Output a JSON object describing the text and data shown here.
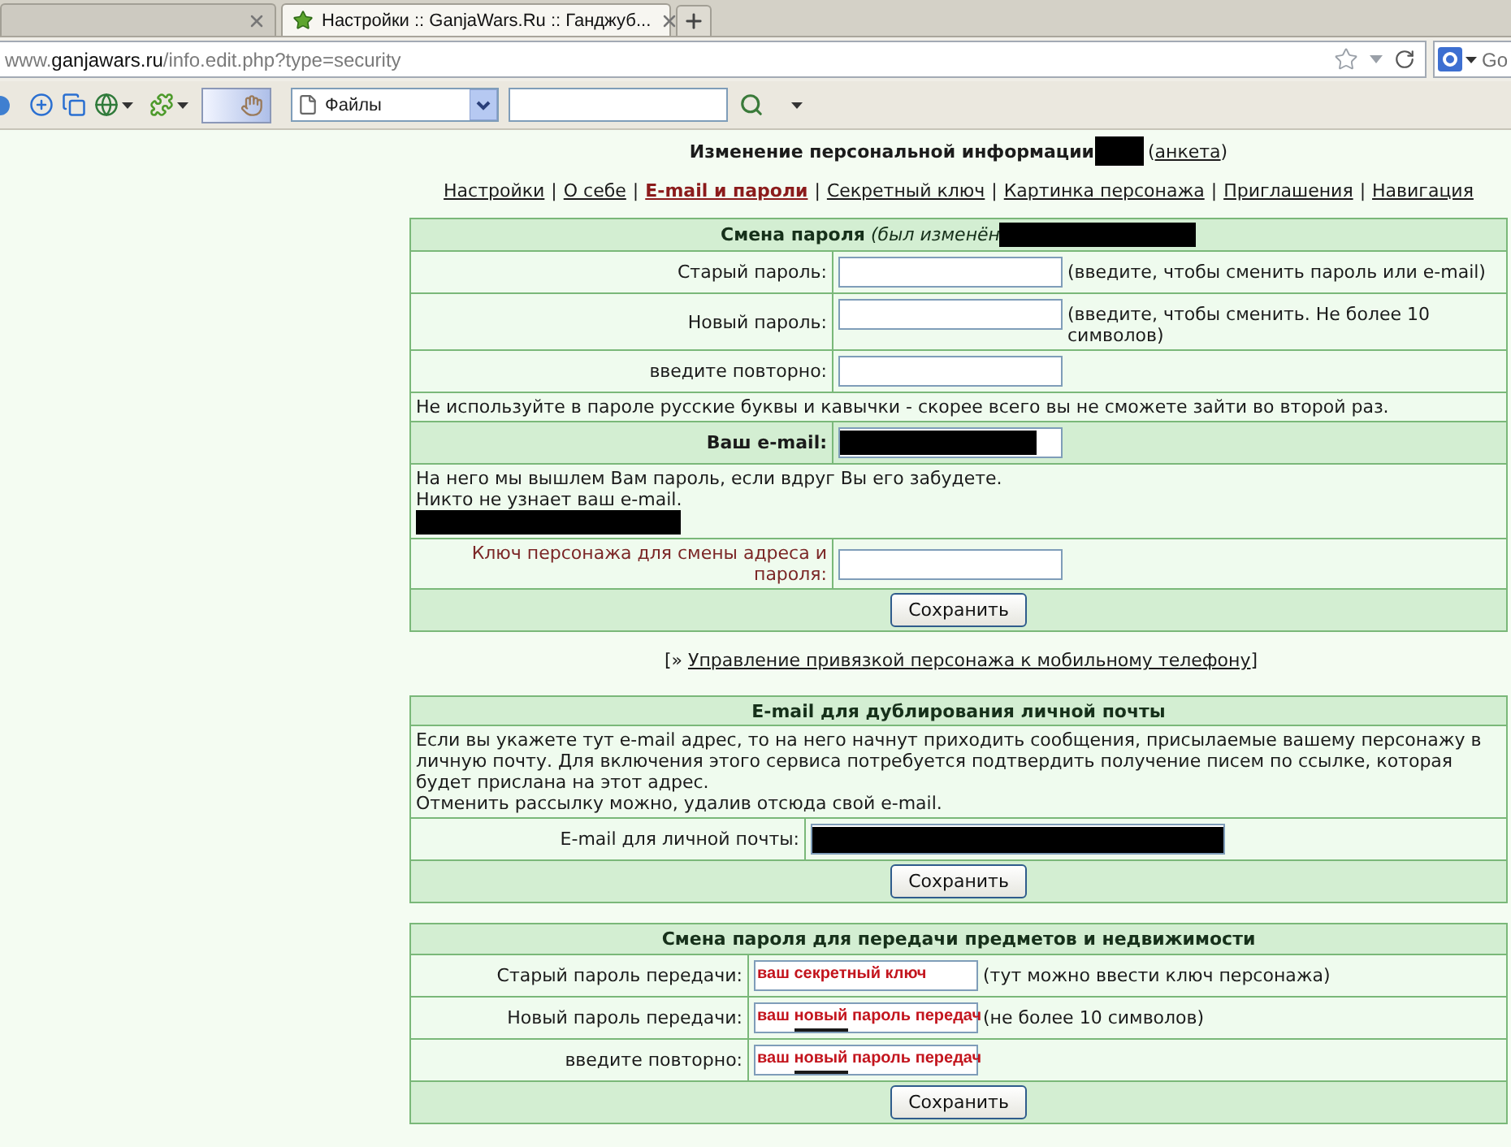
{
  "browser": {
    "tabs": [
      {
        "selected": false
      },
      {
        "title": "Настройки :: GanjaWars.Ru :: Ганджуб...",
        "selected": true
      }
    ],
    "address_bar": {
      "url_prefix": "www.",
      "url_domain": "ganjawars.ru",
      "url_path": "/info.edit.php?type=security"
    },
    "search_box": {
      "placeholder": "Go"
    },
    "toolbar": {
      "select": {
        "value": "Файлы"
      }
    }
  },
  "heading": {
    "text": "Изменение персональной информации",
    "name_redacted": true,
    "link": {
      "open": "(",
      "text": "анкета",
      "close": ")"
    }
  },
  "nav": [
    {
      "label": "Настройки",
      "selected": false,
      "separator": "|"
    },
    {
      "label": "О себе",
      "selected": false,
      "separator": "|"
    },
    {
      "label": "E-mail и пароли",
      "selected": true,
      "separator": "|"
    },
    {
      "label": "Секретный ключ",
      "selected": false,
      "separator": "|"
    },
    {
      "label": "Картинка персонажа",
      "selected": false,
      "separator": "|"
    },
    {
      "label": "Приглашения",
      "selected": false,
      "separator": "|"
    },
    {
      "label": "Навигация",
      "selected": false
    }
  ],
  "password_section": {
    "title": "**Смена пароля** *(был изменён*",
    "title_redacted": true,
    "rows": [
      {
        "kind": "field",
        "label": "Старый пароль:",
        "hint": "(введите, чтобы сменить пароль или e-mail)"
      },
      {
        "kind": "field",
        "label": "Новый пароль:",
        "hint": "(введите, чтобы сменить. Не более 10 символов)"
      },
      {
        "kind": "field",
        "label": "введите повторно:"
      },
      {
        "kind": "note",
        "lines": [
          "Не используйте в пароле русские буквы и кавычки - скорее всего вы не сможете зайти во второй раз."
        ]
      },
      {
        "kind": "email_field",
        "label": "Ваш e-mail:",
        "value_redacted": true
      },
      {
        "kind": "note",
        "lines": [
          "На него мы вышлем Вам пароль, если вдруг Вы его забудете.",
          "Никто не узнает ваш e-mail."
        ],
        "redacted": true
      },
      {
        "kind": "key_field",
        "label": "Ключ персонажа для смены адреса и пароля:"
      },
      {
        "kind": "button",
        "label": "Сохранить"
      }
    ]
  },
  "mobile_link": {
    "open": "[» ",
    "text": "Управление привязкой персонажа к мобильному телефону",
    "close": "]"
  },
  "mail_copy_section": {
    "title": "E-mail для дублирования личной почты",
    "description": [
      "Если вы укажете тут e-mail адрес, то на него начнут приходить сообщения, присылаемые вашему персонажу в личную почту. Для включения этого сервиса потребуется подтвердить получение писем по ссылке, которая будет прислана на этот адрес.",
      "Отменить рассылку можно, удалив отсюда свой e-mail."
    ],
    "field": {
      "label": "E-mail для личной почты:",
      "value_redacted": true
    },
    "button": {
      "label": "Сохранить"
    }
  },
  "transfer_section": {
    "title": "Смена пароля для передачи предметов и недвижимости",
    "rows": [
      {
        "label": "Старый пароль передачи:",
        "value": [
          {
            "text": "ваш секретный ключ",
            "underlined": false
          }
        ],
        "hint": "(тут можно ввести ключ персонажа)"
      },
      {
        "label": "Новый пароль передачи:",
        "value": [
          {
            "text": "ваш ",
            "underlined": false
          },
          {
            "text": "новый",
            "underlined": true
          },
          {
            "text": " пароль передач",
            "underlined": false
          }
        ],
        "hint": "(не более 10 символов)"
      },
      {
        "label": "введите повторно:",
        "value": [
          {
            "text": "ваш ",
            "underlined": false
          },
          {
            "text": "новый",
            "underlined": true
          },
          {
            "text": " пароль передач",
            "underlined": false
          }
        ]
      }
    ],
    "button": {
      "label": "Сохранить"
    }
  }
}
